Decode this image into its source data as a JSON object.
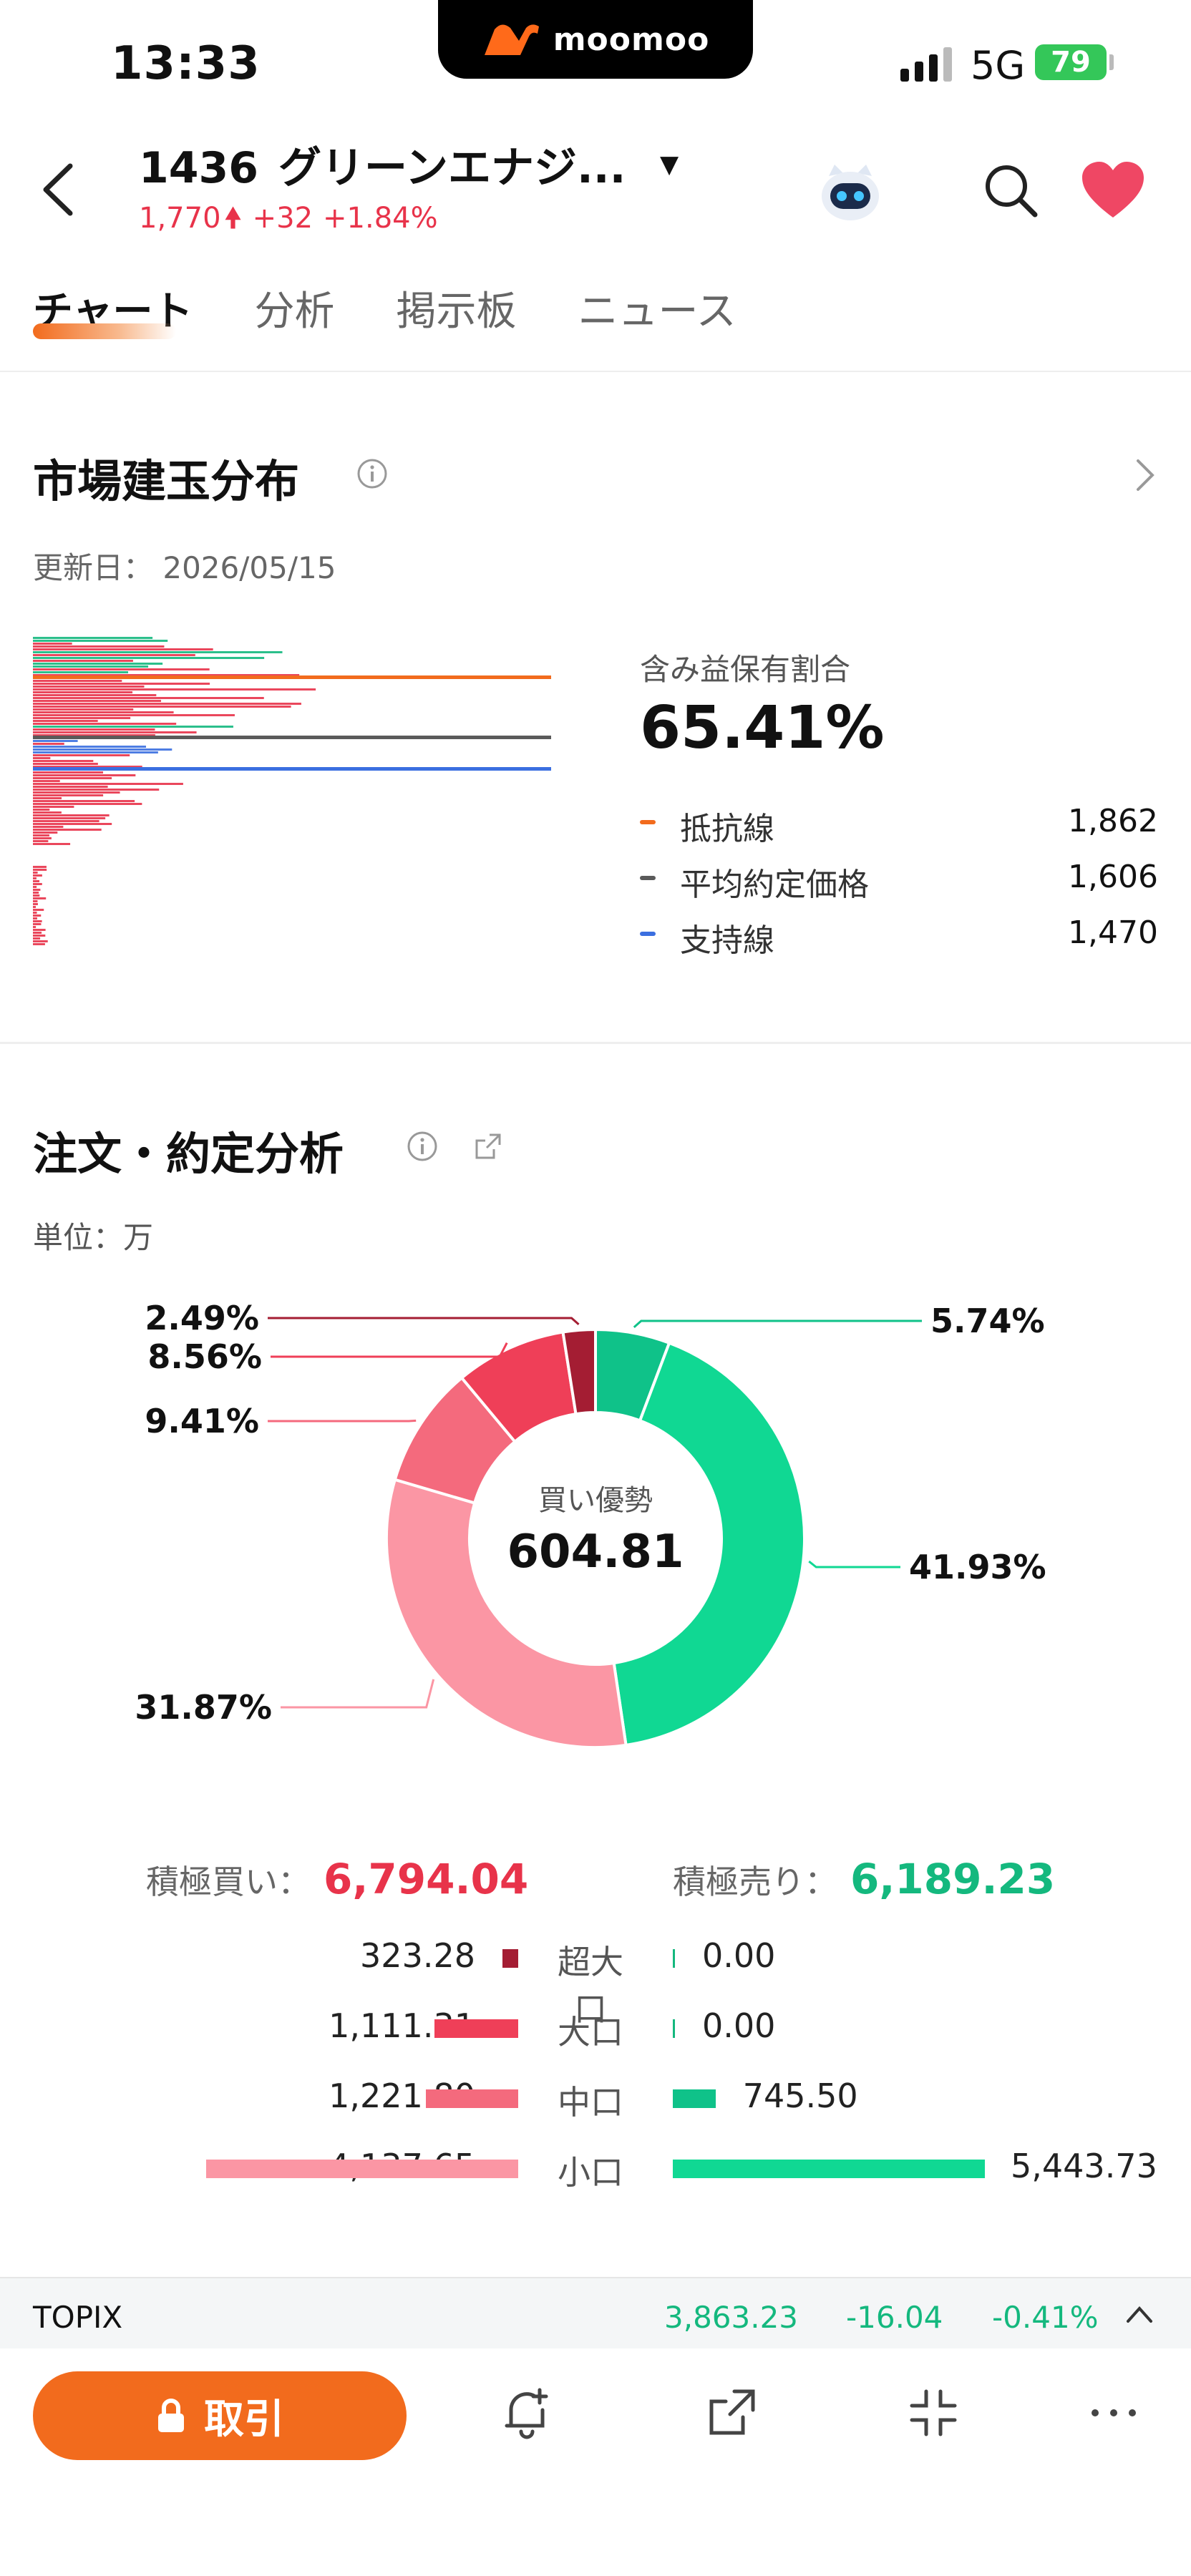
{
  "status_bar": {
    "time": "13:33",
    "network": "5G",
    "battery": "79"
  },
  "brand": "moomoo",
  "header": {
    "code": "1436",
    "name": "グリーンエナジ...",
    "price": "1,770",
    "change": "+32",
    "change_pct": "+1.84%"
  },
  "tabs": [
    "チャート",
    "分析",
    "掲示板",
    "ニュース"
  ],
  "position_distribution": {
    "title": "市場建玉分布",
    "updated": "更新日： 2026/05/15",
    "share_label": "含み益保有割合",
    "share_value": "65.41%",
    "legend": [
      {
        "label": "抵抗線",
        "value": "1,862",
        "color": "#f26b1d"
      },
      {
        "label": "平均約定価格",
        "value": "1,606",
        "color": "#5a5a5a"
      },
      {
        "label": "支持線",
        "value": "1,470",
        "color": "#3b6fe0"
      }
    ]
  },
  "order_analysis": {
    "title": "注文・約定分析",
    "unit": "単位：万",
    "center_label": "買い優勢",
    "center_value": "604.81",
    "buy_label": "積極買い：",
    "buy_total": "6,794.04",
    "sell_label": "積極売り：",
    "sell_total": "6,189.23",
    "rows": [
      {
        "category": "超大口",
        "buy": "323.28",
        "sell": "0.00",
        "buy_frac": 0.078,
        "sell_frac": 0.0
      },
      {
        "category": "大口",
        "buy": "1,111.31",
        "sell": "0.00",
        "buy_frac": 0.269,
        "sell_frac": 0.0
      },
      {
        "category": "中口",
        "buy": "1,221.80",
        "sell": "745.50",
        "buy_frac": 0.295,
        "sell_frac": 0.137
      },
      {
        "category": "小口",
        "buy": "4,137.65",
        "sell": "5,443.73",
        "buy_frac": 1.0,
        "sell_frac": 1.0
      }
    ]
  },
  "chart_data": {
    "type": "pie",
    "title": "",
    "slices": [
      {
        "value": 5.74,
        "label": "5.74%",
        "color": "#0fc289"
      },
      {
        "value": 41.93,
        "label": "41.93%",
        "color": "#10d893"
      },
      {
        "value": 31.87,
        "label": "31.87%",
        "color": "#fb96a4"
      },
      {
        "value": 9.41,
        "label": "9.41%",
        "color": "#f46a7d"
      },
      {
        "value": 8.56,
        "label": "8.56%",
        "color": "#ef3f58"
      },
      {
        "value": 2.49,
        "label": "2.49%",
        "color": "#a41d33"
      }
    ]
  },
  "index_bar": {
    "name": "TOPIX",
    "value": "3,863.23",
    "change": "-16.04",
    "change_pct": "-0.41%"
  },
  "toolbar": {
    "trade_label": "取引"
  },
  "colors": {
    "accent": "#f26b1d",
    "up": "#e8334a",
    "down_green": "#14b87e"
  }
}
